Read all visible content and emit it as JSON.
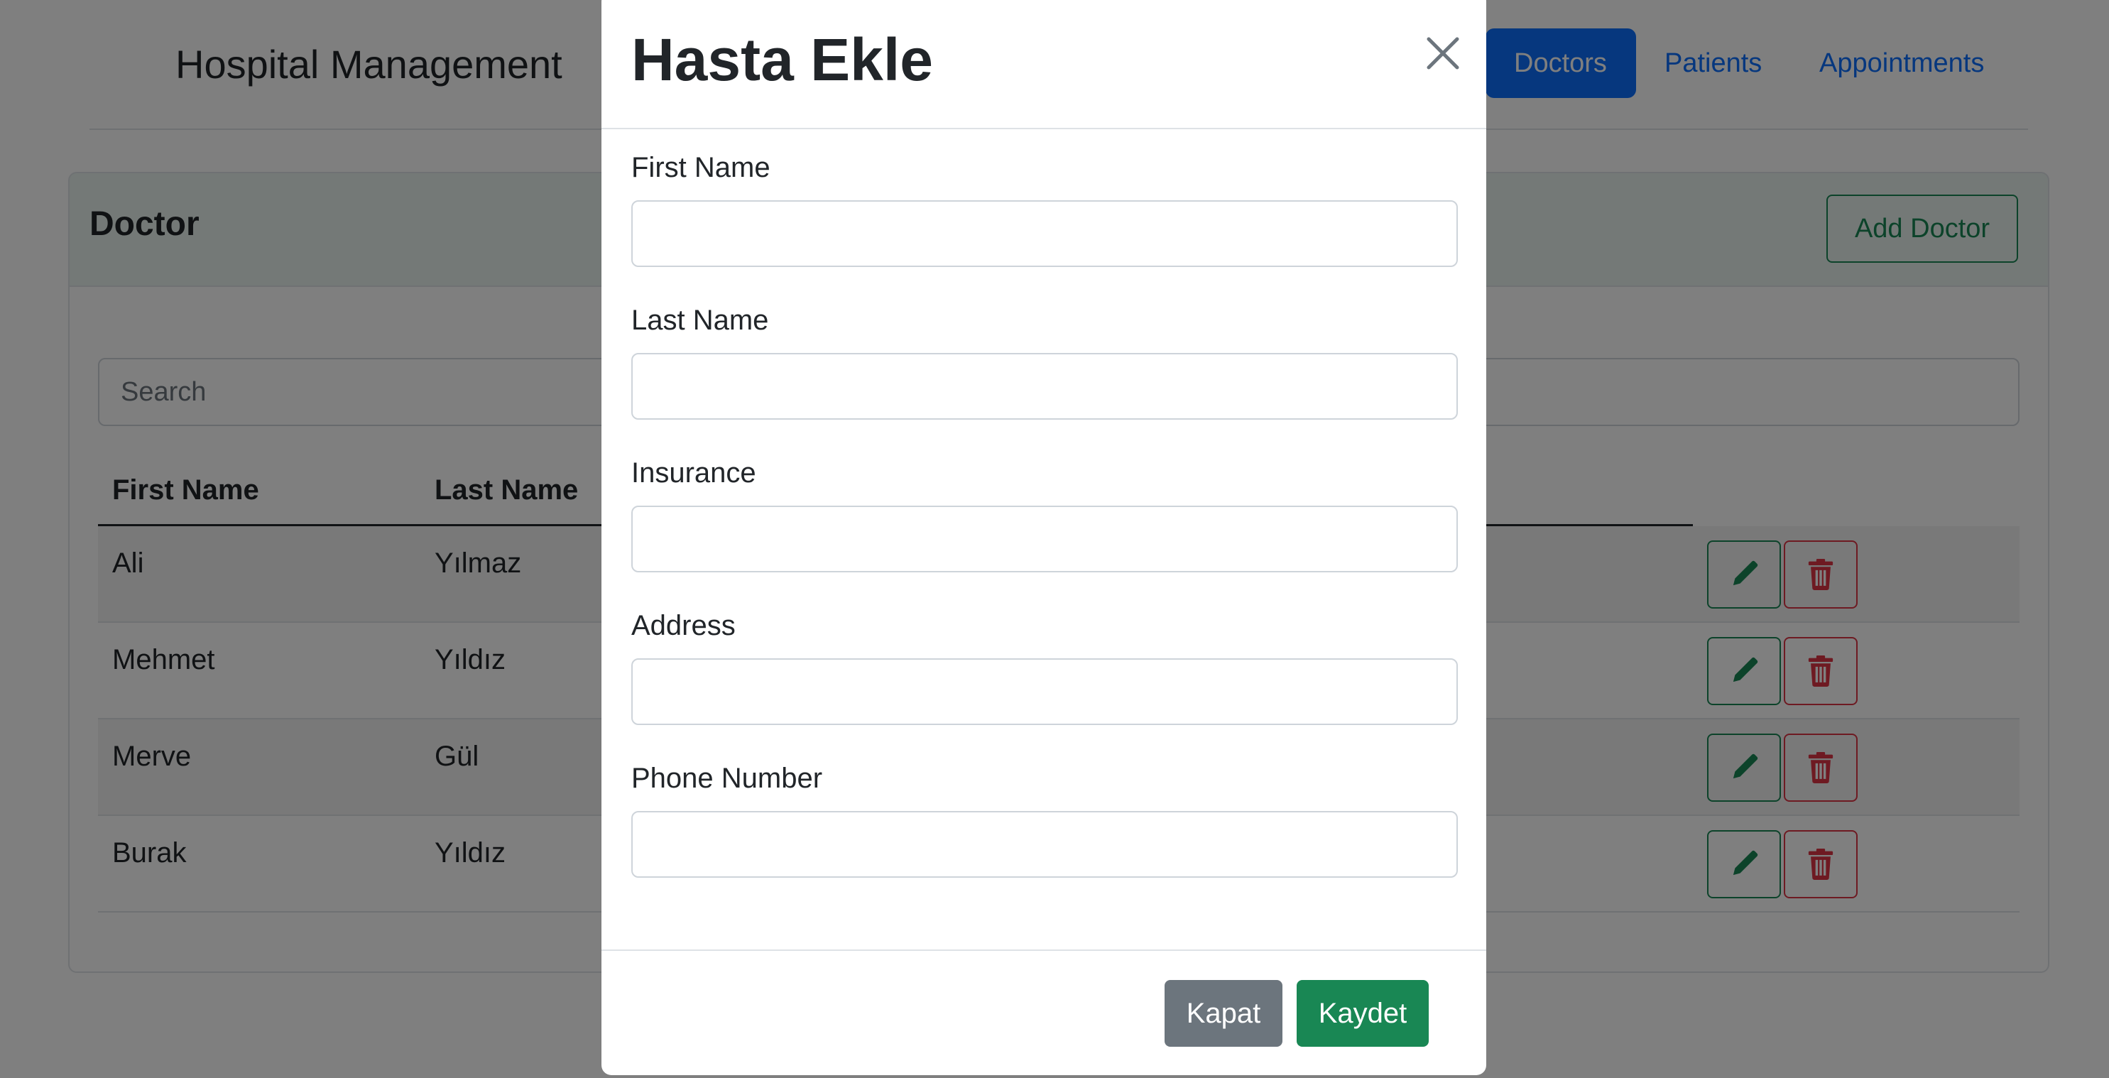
{
  "app": {
    "brand": "Hospital Management",
    "nav": [
      {
        "label": "Doctors",
        "active": true
      },
      {
        "label": "Patients",
        "active": false
      },
      {
        "label": "Appointments",
        "active": false
      }
    ]
  },
  "card": {
    "title": "Doctor",
    "add_button": "Add Doctor",
    "search_placeholder": "Search"
  },
  "table": {
    "headers": [
      "First Name",
      "Last Name"
    ],
    "rows": [
      {
        "first": "Ali",
        "last": "Yılmaz"
      },
      {
        "first": "Mehmet",
        "last": "Yıldız"
      },
      {
        "first": "Merve",
        "last": "Gül"
      },
      {
        "first": "Burak",
        "last": "Yıldız"
      }
    ],
    "edit_icon": "pencil-icon",
    "delete_icon": "trash-icon"
  },
  "modal": {
    "title": "Hasta Ekle",
    "fields": [
      {
        "label": "First Name",
        "value": ""
      },
      {
        "label": "Last Name",
        "value": ""
      },
      {
        "label": "Insurance",
        "value": ""
      },
      {
        "label": "Address",
        "value": ""
      },
      {
        "label": "Phone Number",
        "value": ""
      }
    ],
    "close_button": "Kapat",
    "save_button": "Kaydet"
  },
  "colors": {
    "primary": "#0d6efd",
    "success": "#198754",
    "danger": "#dc3545",
    "secondary": "#6c757d"
  }
}
